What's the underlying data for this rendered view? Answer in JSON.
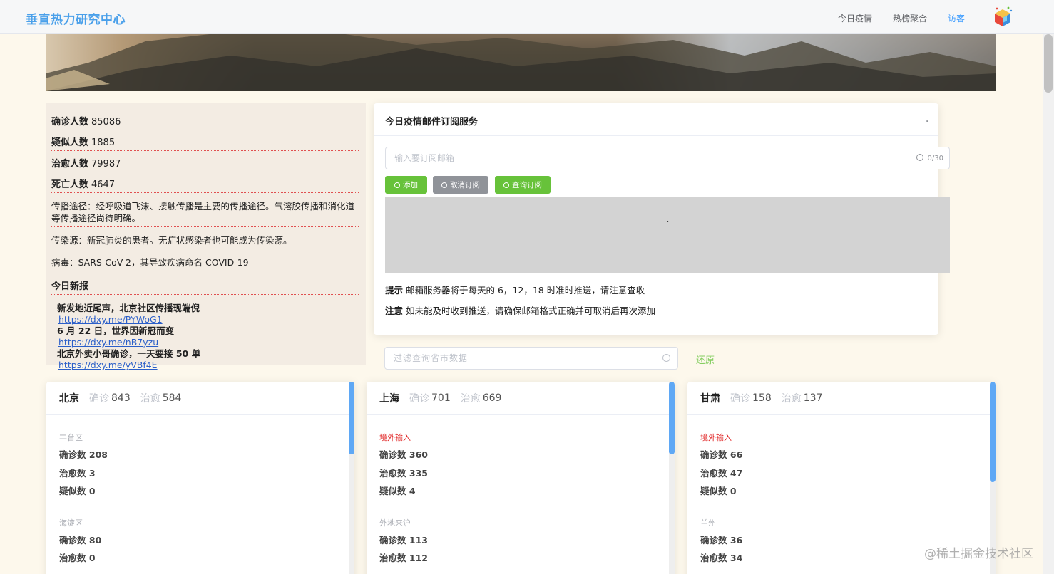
{
  "nav": {
    "brand": "垂直热力研究中心",
    "items": [
      "今日疫情",
      "热榜聚合",
      "访客"
    ]
  },
  "stats": {
    "rows": [
      {
        "label": "确诊人数",
        "value": "85086"
      },
      {
        "label": "疑似人数",
        "value": "1885"
      },
      {
        "label": "治愈人数",
        "value": "79987"
      },
      {
        "label": "死亡人数",
        "value": "4647"
      }
    ],
    "transmission": "传播途径：经呼吸道飞沫、接触传播是主要的传播途径。气溶胶传播和消化道等传播途径尚待明确。",
    "source": "传染源：新冠肺炎的患者。无症状感染者也可能成为传染源。",
    "virus": "病毒：SARS-CoV-2，其导致疾病命名 COVID-19",
    "news_title": "今日新报",
    "news": [
      {
        "title": "新发地近尾声，北京社区传播现端倪",
        "link": "https://dxy.me/PYWoG1"
      },
      {
        "title": "6 月 22 日，世界因新冠而变",
        "link": "https://dxy.me/nB7yzu"
      },
      {
        "title": "北京外卖小哥确诊，一天要接 50 单",
        "link": "https://dxy.me/yVBf4E"
      }
    ]
  },
  "subscribe": {
    "title": "今日疫情邮件订阅服务",
    "corner": ".",
    "placeholder": "输入要订阅邮箱",
    "count": "0/30",
    "buttons": {
      "add": "添加",
      "cancel": "取消订阅",
      "query": "查询订阅"
    },
    "box_text": ".",
    "tip1_label": "提示",
    "tip1": "邮箱服务器将于每天的 6，12，18 时准时推送，请注意查收",
    "tip2_label": "注意",
    "tip2": "如未能及时收到推送，请确保邮箱格式正确并可取消后再次添加"
  },
  "filter": {
    "placeholder": "过滤查询省市数据",
    "restore": "还原"
  },
  "labels": {
    "confirmed": "确诊",
    "cured": "治愈",
    "c_count": "确诊数",
    "h_count": "治愈数",
    "s_count": "疑似数"
  },
  "cities": [
    {
      "name": "北京",
      "confirmed": "843",
      "cured": "584",
      "districts": [
        {
          "name": "丰台区",
          "c": "208",
          "h": "3",
          "s": "0",
          "red": false
        },
        {
          "name": "海淀区",
          "c": "80",
          "h": "0",
          "s": "",
          "red": false
        }
      ]
    },
    {
      "name": "上海",
      "confirmed": "701",
      "cured": "669",
      "districts": [
        {
          "name": "境外输入",
          "c": "360",
          "h": "335",
          "s": "4",
          "red": true
        },
        {
          "name": "外地来沪",
          "c": "113",
          "h": "112",
          "s": "",
          "red": false
        }
      ]
    },
    {
      "name": "甘肃",
      "confirmed": "158",
      "cured": "137",
      "districts": [
        {
          "name": "境外输入",
          "c": "66",
          "h": "47",
          "s": "0",
          "red": true
        },
        {
          "name": "兰州",
          "c": "36",
          "h": "34",
          "s": "",
          "red": false
        }
      ]
    }
  ],
  "watermark": "@稀土掘金技术社区",
  "colors": {
    "accent": "#409eff",
    "green": "#67c23a",
    "gray": "#909399",
    "red": "#e02020",
    "background": "#fdf8ec"
  }
}
